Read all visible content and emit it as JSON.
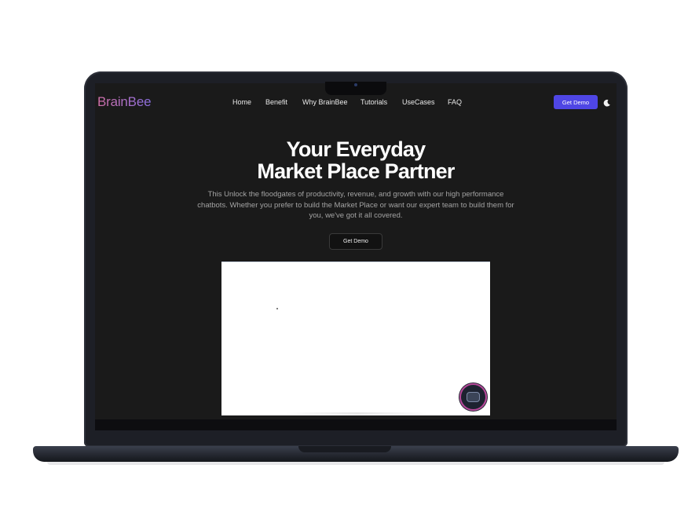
{
  "header": {
    "logo": "BrainBee",
    "nav": [
      {
        "label": "Home"
      },
      {
        "label": "Benefit"
      },
      {
        "label": "Why BrainBee"
      },
      {
        "label": "Tutorials"
      },
      {
        "label": "UseCases"
      },
      {
        "label": "FAQ"
      }
    ],
    "cta_label": "Get Demo",
    "theme_icon": "moon-icon"
  },
  "hero": {
    "title_line1": "Your Everyday",
    "title_line2": "Market Place Partner",
    "subtitle": "This Unlock the floodgates of productivity, revenue, and growth with our high performance chatbots. Whether you prefer to build the Market Place or want our expert team to build them for you, we've got it all covered.",
    "button_label": "Get Demo"
  },
  "widget": {
    "icon": "chat-bot-icon"
  },
  "colors": {
    "accent": "#4f46e5",
    "background": "#1a1a1a",
    "logo_gradient_start": "#d06fa7",
    "logo_gradient_end": "#8a6fe0"
  }
}
